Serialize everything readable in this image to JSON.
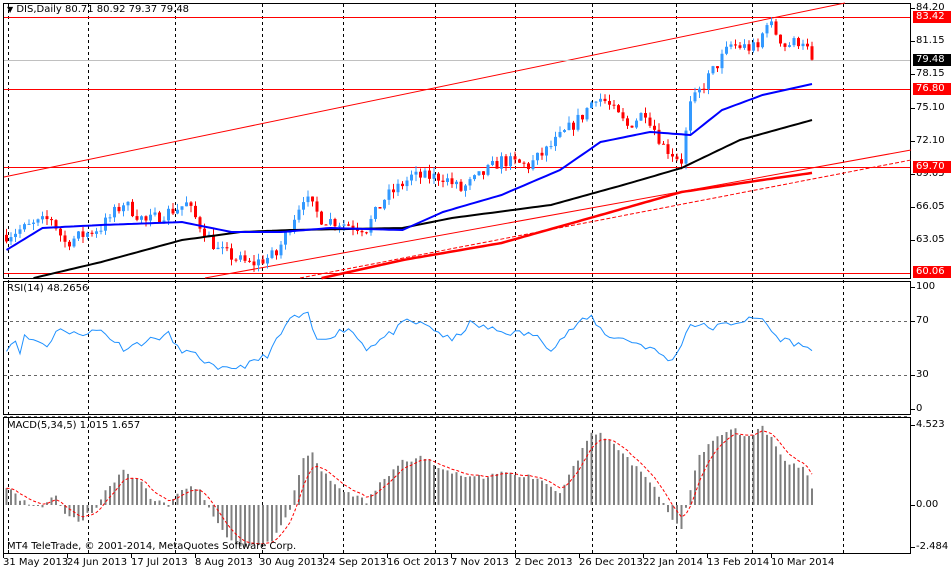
{
  "header": {
    "symbol_info": "DIS,Daily  80.71 80.92 79.37 79.48"
  },
  "colors": {
    "bull": "#3399ff",
    "bear": "#ff0000",
    "ma_fast": "#0000ff",
    "ma_mid": "#000000",
    "ma_slow": "#ff0000",
    "level": "#ff0000",
    "rsi": "#1e90ff",
    "macd_hist": "#808080",
    "macd_signal": "#ff0000"
  },
  "price_axis": {
    "ticks": [
      "84.20",
      "81.15",
      "78.15",
      "75.10",
      "72.10",
      "69.05",
      "66.05",
      "63.05"
    ],
    "tick_values": [
      84.2,
      81.15,
      78.15,
      75.1,
      72.1,
      69.05,
      66.05,
      63.05
    ],
    "range": [
      60.06,
      84.2
    ]
  },
  "levels": [
    {
      "label": "83.42",
      "value": 83.42
    },
    {
      "label": "76.80",
      "value": 76.8
    },
    {
      "label": "69.70",
      "value": 69.7
    },
    {
      "label": "60.06",
      "value": 60.06
    }
  ],
  "current_price": {
    "label": "79.48",
    "value": 79.48
  },
  "price_path": [
    [
      0,
      63.5
    ],
    [
      10,
      65
    ],
    [
      13,
      62.8
    ],
    [
      21,
      64.2
    ],
    [
      26,
      66.4
    ],
    [
      31,
      64.7
    ],
    [
      40,
      66.3
    ],
    [
      43,
      64.4
    ],
    [
      47,
      62.1
    ],
    [
      54,
      60.8
    ],
    [
      60,
      61.7
    ],
    [
      66,
      67
    ],
    [
      70,
      65
    ],
    [
      80,
      64.1
    ],
    [
      84,
      66.8
    ],
    [
      90,
      68.8
    ],
    [
      97,
      68.8
    ],
    [
      101,
      67.6
    ],
    [
      110,
      70.3
    ],
    [
      116,
      69.8
    ],
    [
      120,
      71.2
    ],
    [
      128,
      74.4
    ],
    [
      131,
      76.2
    ],
    [
      133,
      75.7
    ],
    [
      138,
      73.4
    ],
    [
      142,
      74.8
    ],
    [
      146,
      71.6
    ],
    [
      150,
      70.3
    ],
    [
      152,
      75.3
    ],
    [
      157,
      78.5
    ],
    [
      161,
      80.8
    ],
    [
      167,
      80.5
    ],
    [
      169,
      83.1
    ],
    [
      173,
      80.8
    ],
    [
      177,
      81.3
    ],
    [
      179,
      79.48
    ]
  ],
  "ma_fast": [
    [
      0,
      62.12
    ],
    [
      8,
      64.13
    ],
    [
      21,
      64.4
    ],
    [
      39,
      64.67
    ],
    [
      50,
      63.76
    ],
    [
      61,
      63.76
    ],
    [
      72,
      64.13
    ],
    [
      88,
      63.94
    ],
    [
      97,
      65.59
    ],
    [
      110,
      67.14
    ],
    [
      123,
      69.42
    ],
    [
      132,
      71.97
    ],
    [
      143,
      72.89
    ],
    [
      152,
      72.61
    ],
    [
      159,
      74.89
    ],
    [
      168,
      76.26
    ],
    [
      179,
      77.27
    ]
  ],
  "ma_mid": [
    [
      6,
      59.56
    ],
    [
      21,
      61.02
    ],
    [
      39,
      63.03
    ],
    [
      52,
      63.76
    ],
    [
      63,
      63.94
    ],
    [
      88,
      64.13
    ],
    [
      99,
      65.04
    ],
    [
      121,
      66.23
    ],
    [
      137,
      68.05
    ],
    [
      150,
      69.6
    ],
    [
      163,
      72.16
    ],
    [
      179,
      73.98
    ]
  ],
  "ma_slow": [
    [
      70,
      59.56
    ],
    [
      88,
      61.2
    ],
    [
      110,
      62.76
    ],
    [
      132,
      65.31
    ],
    [
      150,
      67.41
    ],
    [
      168,
      68.51
    ],
    [
      179,
      69.15
    ]
  ],
  "rsi": {
    "title": "RSI(14) 48.2656",
    "ticks": [
      "100",
      "70",
      "30",
      "0"
    ],
    "tick_values": [
      100,
      70,
      30,
      0
    ],
    "path": [
      [
        0,
        50
      ],
      [
        2,
        56
      ],
      [
        3,
        48
      ],
      [
        4,
        58
      ],
      [
        7,
        55
      ],
      [
        9,
        52
      ],
      [
        12,
        66
      ],
      [
        14,
        60
      ],
      [
        21,
        63
      ],
      [
        26,
        50
      ],
      [
        36,
        60
      ],
      [
        38,
        50
      ],
      [
        43,
        43
      ],
      [
        47,
        33
      ],
      [
        51,
        36
      ],
      [
        54,
        38
      ],
      [
        58,
        45
      ],
      [
        61,
        60
      ],
      [
        63,
        72
      ],
      [
        67,
        74
      ],
      [
        69,
        55
      ],
      [
        76,
        65
      ],
      [
        80,
        50
      ],
      [
        86,
        62
      ],
      [
        89,
        70
      ],
      [
        94,
        66
      ],
      [
        99,
        55
      ],
      [
        103,
        68
      ],
      [
        110,
        62
      ],
      [
        117,
        60
      ],
      [
        121,
        50
      ],
      [
        127,
        68
      ],
      [
        130,
        73
      ],
      [
        133,
        60
      ],
      [
        139,
        55
      ],
      [
        143,
        50
      ],
      [
        148,
        40
      ],
      [
        152,
        68
      ],
      [
        157,
        65
      ],
      [
        163,
        70
      ],
      [
        168,
        72
      ],
      [
        171,
        58
      ],
      [
        174,
        55
      ],
      [
        178,
        50
      ],
      [
        179,
        48
      ]
    ]
  },
  "macd": {
    "title": "MACD(5,34,5) 1.015 1.657",
    "ticks": [
      "4.523",
      "0.00",
      "-2.484"
    ],
    "tick_values": [
      4.523,
      0,
      -2.484
    ],
    "path": [
      [
        0,
        1.1
      ],
      [
        3,
        0.3
      ],
      [
        8,
        -0.1
      ],
      [
        11,
        0.5
      ],
      [
        13,
        -0.4
      ],
      [
        16,
        -0.9
      ],
      [
        19,
        -0.4
      ],
      [
        22,
        0.7
      ],
      [
        26,
        2.0
      ],
      [
        30,
        1.3
      ],
      [
        32,
        0.4
      ],
      [
        36,
        0
      ],
      [
        40,
        1.0
      ],
      [
        43,
        0.8
      ],
      [
        47,
        -1.0
      ],
      [
        50,
        -2.1
      ],
      [
        54,
        -2.4
      ],
      [
        59,
        -2.0
      ],
      [
        63,
        -0.3
      ],
      [
        66,
        2.7
      ],
      [
        68,
        2.9
      ],
      [
        70,
        1.9
      ],
      [
        74,
        0.9
      ],
      [
        80,
        0.2
      ],
      [
        83,
        1.3
      ],
      [
        88,
        2.4
      ],
      [
        92,
        2.7
      ],
      [
        97,
        2.1
      ],
      [
        103,
        1.5
      ],
      [
        110,
        1.8
      ],
      [
        117,
        1.6
      ],
      [
        123,
        0.8
      ],
      [
        127,
        2.6
      ],
      [
        130,
        4.1
      ],
      [
        132,
        4.0
      ],
      [
        136,
        3.1
      ],
      [
        141,
        1.8
      ],
      [
        145,
        0.6
      ],
      [
        147,
        -0.5
      ],
      [
        150,
        -1.3
      ],
      [
        152,
        0.8
      ],
      [
        154,
        2.8
      ],
      [
        158,
        4.0
      ],
      [
        161,
        4.3
      ],
      [
        165,
        3.9
      ],
      [
        168,
        4.4
      ],
      [
        170,
        3.8
      ],
      [
        173,
        2.4
      ],
      [
        177,
        2.1
      ],
      [
        179,
        1.0
      ]
    ]
  },
  "footer": {
    "copyright": "MT4 TeleTrade, © 2001-2014, MetaQuotes Software Corp."
  },
  "time_axis": [
    "31 May 2013",
    "24 Jun 2013",
    "17 Jul 2013",
    "8 Aug 2013",
    "30 Aug 2013",
    "24 Sep 2013",
    "16 Oct 2013",
    "7 Nov 2013",
    "2 Dec 2013",
    "26 Dec 2013",
    "22 Jan 2014",
    "13 Feb 2014",
    "10 Mar 2014"
  ]
}
